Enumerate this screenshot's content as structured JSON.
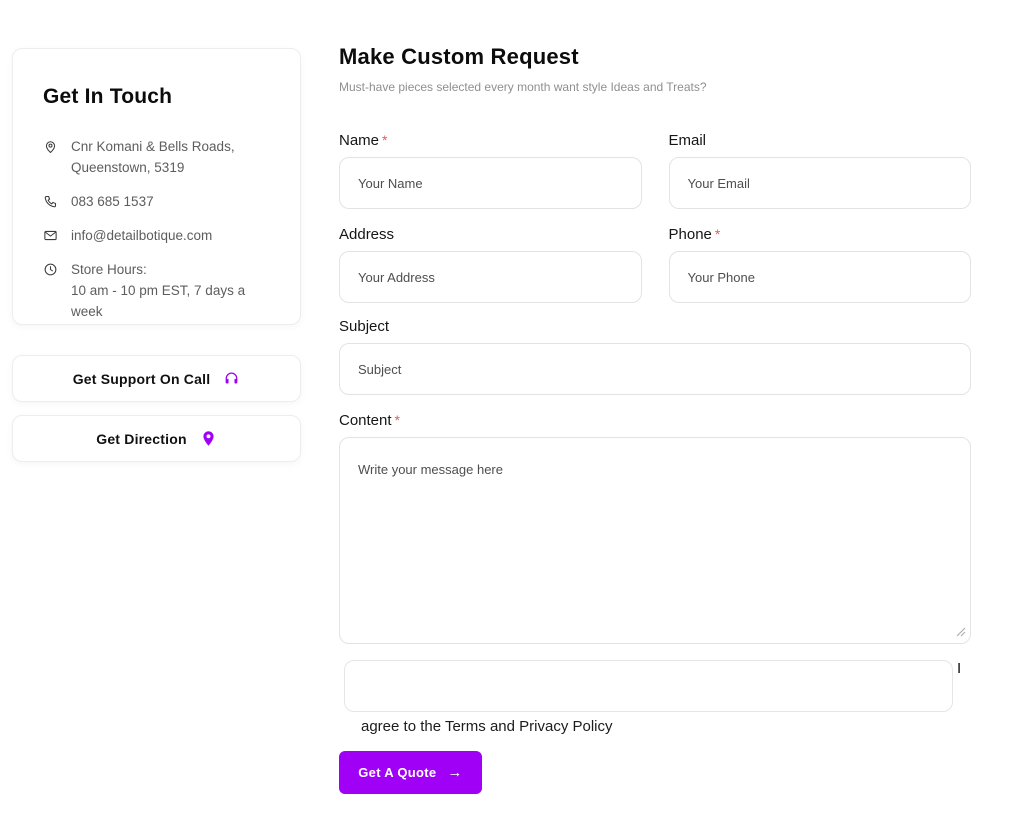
{
  "colors": {
    "accent": "#a000f5",
    "required": "#e05d5d"
  },
  "sidebar": {
    "contact_card": {
      "title": "Get In Touch",
      "address": {
        "icon": "location-pin-icon",
        "line1": "Cnr Komani & Bells Roads,",
        "line2": "Queenstown, 5319"
      },
      "phone": {
        "icon": "phone-icon",
        "text": "083 685 1537"
      },
      "email": {
        "icon": "envelope-icon",
        "text": "info@detailbotique.com"
      },
      "hours": {
        "icon": "clock-icon",
        "line1": "Store Hours:",
        "line2": "10 am - 10 pm EST, 7 days a week"
      }
    },
    "support_button": {
      "label": "Get Support On Call",
      "icon": "headphones-icon"
    },
    "direction_button": {
      "label": "Get Direction",
      "icon": "location-pin-filled-icon"
    }
  },
  "form": {
    "title": "Make Custom Request",
    "subtitle": "Must-have pieces selected every month want style Ideas and Treats?",
    "required_marker": "*",
    "fields": {
      "name": {
        "label": "Name",
        "required": true,
        "placeholder": "Your Name"
      },
      "email": {
        "label": "Email",
        "required": false,
        "placeholder": "Your Email"
      },
      "address": {
        "label": "Address",
        "required": false,
        "placeholder": "Your Address"
      },
      "phone": {
        "label": "Phone",
        "required": true,
        "placeholder": "Your Phone"
      },
      "subject": {
        "label": "Subject",
        "required": false,
        "placeholder": "Subject"
      },
      "content": {
        "label": "Content",
        "required": true,
        "placeholder": "Write your message here"
      }
    },
    "agreement": {
      "prefix": "I",
      "text": "agree to the Terms and Privacy Policy"
    },
    "submit_button": {
      "label": "Get A Quote",
      "arrow": "→"
    }
  }
}
